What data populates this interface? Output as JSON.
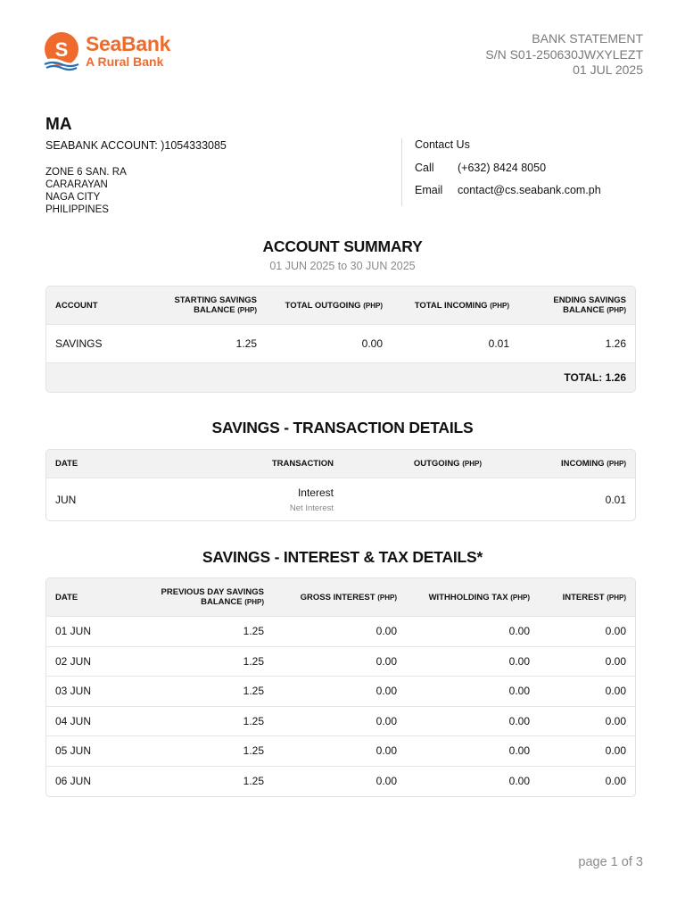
{
  "brand": {
    "name": "SeaBank",
    "tagline": "A Rural Bank",
    "icon": "seabank-logo-icon",
    "color": "#ee6b2d"
  },
  "statement": {
    "doc_type": "BANK STATEMENT",
    "serial": "S/N S01-250630JWXYLEZT",
    "date": "01 JUL 2025"
  },
  "customer": {
    "name": "MA",
    "account": "SEABANK ACCOUNT: )1054333085",
    "address": [
      "ZONE 6 SAN. RA",
      "CARARAYAN",
      "NAGA CITY",
      "PHILIPPINES"
    ]
  },
  "contact": {
    "title": "Contact Us",
    "call_label": "Call",
    "call_value": "(+632) 8424 8050",
    "email_label": "Email",
    "email_value": "contact@cs.seabank.com.ph"
  },
  "summary": {
    "title": "ACCOUNT SUMMARY",
    "period": "01 JUN 2025 to 30 JUN 2025",
    "headers": {
      "account": "ACCOUNT",
      "starting_1": "STARTING SAVINGS",
      "starting_2": "BALANCE",
      "outgoing": "TOTAL OUTGOING",
      "incoming": "TOTAL INCOMING",
      "ending_1": "ENDING SAVINGS",
      "ending_2": "BALANCE",
      "unit": "(PHP)"
    },
    "row": {
      "account": "SAVINGS",
      "starting": "1.25",
      "outgoing": "0.00",
      "incoming": "0.01",
      "ending": "1.26"
    },
    "total": "TOTAL: 1.26"
  },
  "transactions": {
    "title": "SAVINGS - TRANSACTION DETAILS",
    "headers": {
      "date": "DATE",
      "transaction": "TRANSACTION",
      "outgoing": "OUTGOING",
      "incoming": "INCOMING",
      "unit": "(PHP)"
    },
    "rows": [
      {
        "date": "JUN",
        "transaction": "Interest",
        "detail": "Net Interest",
        "outgoing": "",
        "incoming": "0.01"
      }
    ]
  },
  "interest": {
    "title": "SAVINGS - INTEREST & TAX DETAILS*",
    "headers": {
      "date": "DATE",
      "prev_1": "PREVIOUS DAY SAVINGS",
      "prev_2": "BALANCE",
      "gross": "GROSS INTEREST",
      "tax": "WITHHOLDING TAX",
      "interest": "INTEREST",
      "unit": "(PHP)"
    },
    "rows": [
      {
        "date": "01 JUN",
        "balance": "1.25",
        "gross": "0.00",
        "tax": "0.00",
        "interest": "0.00"
      },
      {
        "date": "02 JUN",
        "balance": "1.25",
        "gross": "0.00",
        "tax": "0.00",
        "interest": "0.00"
      },
      {
        "date": "03 JUN",
        "balance": "1.25",
        "gross": "0.00",
        "tax": "0.00",
        "interest": "0.00"
      },
      {
        "date": "04 JUN",
        "balance": "1.25",
        "gross": "0.00",
        "tax": "0.00",
        "interest": "0.00"
      },
      {
        "date": "05 JUN",
        "balance": "1.25",
        "gross": "0.00",
        "tax": "0.00",
        "interest": "0.00"
      },
      {
        "date": "06 JUN",
        "balance": "1.25",
        "gross": "0.00",
        "tax": "0.00",
        "interest": "0.00"
      }
    ]
  },
  "footer": {
    "page": "page 1 of 3"
  }
}
